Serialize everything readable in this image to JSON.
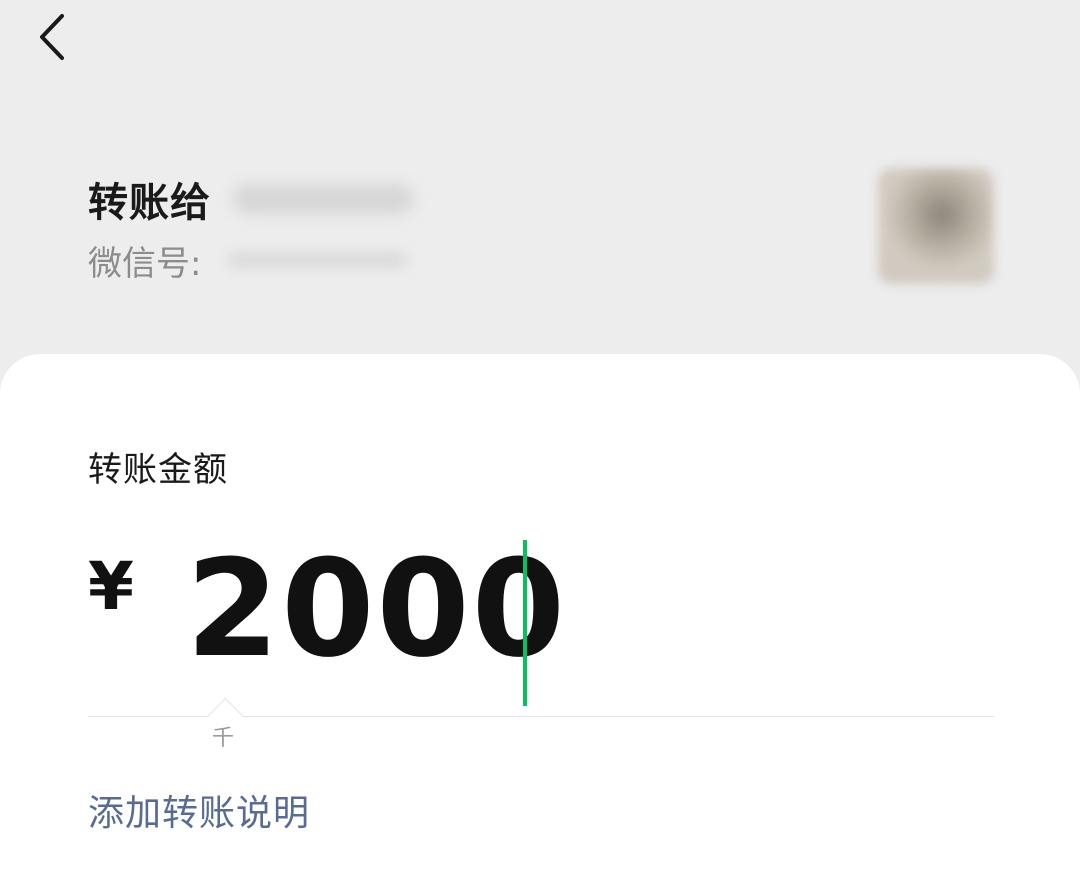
{
  "header": {
    "back_icon": "chevron-left-icon"
  },
  "recipient": {
    "title": "转账给",
    "wechat_id_label": "微信号:"
  },
  "transfer": {
    "amount_label": "转账金额",
    "currency_symbol": "¥",
    "amount": "2000",
    "unit_hint": "千",
    "add_note_label": "添加转账说明"
  },
  "colors": {
    "background": "#ededed",
    "card": "#ffffff",
    "caret": "#07c160",
    "link": "#576b95"
  }
}
